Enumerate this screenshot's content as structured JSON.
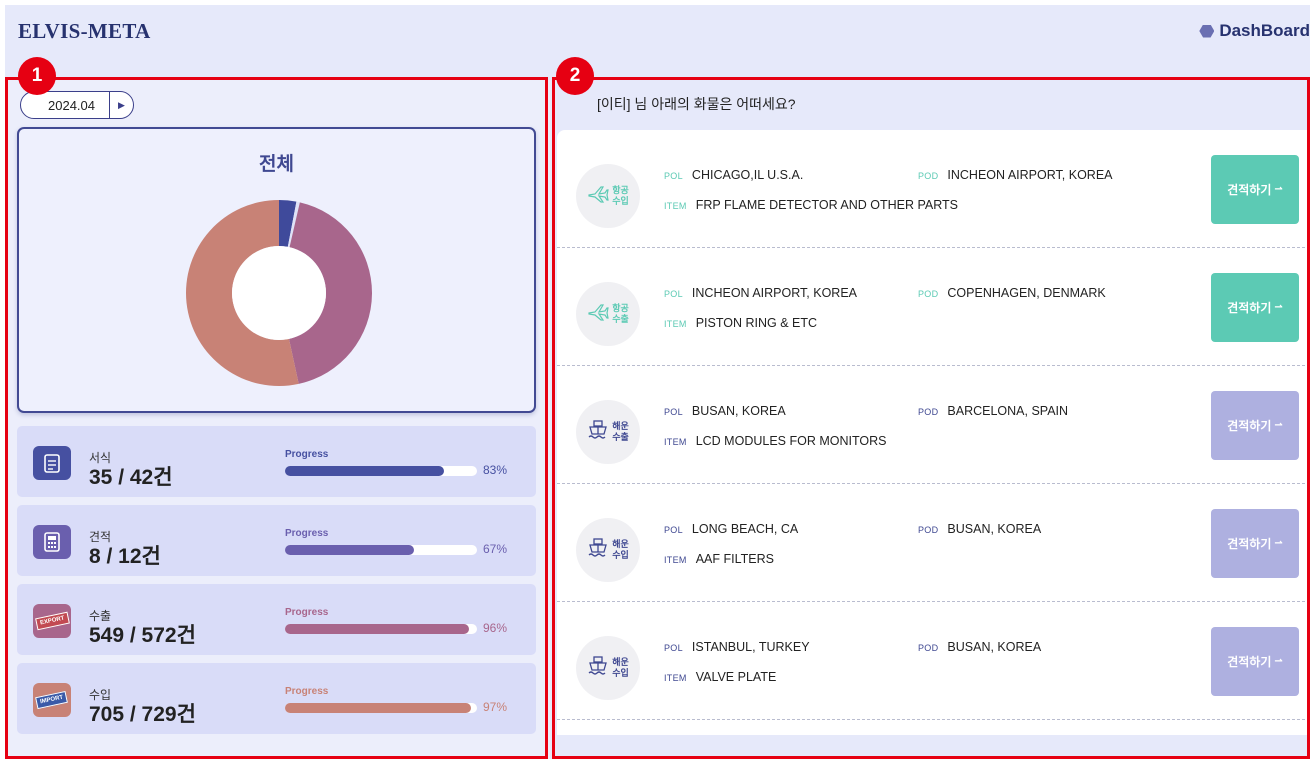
{
  "header": {
    "logo": "ELVIS-META",
    "dashboard_label": "DashBoard"
  },
  "annotations": {
    "box1": "1",
    "box2": "2"
  },
  "left_panel": {
    "month": "2024.04",
    "chart_title": "전체",
    "donut_segments": [
      {
        "value": 3,
        "color": "#3f4a9b"
      },
      {
        "value": 0.6,
        "color": "#dfe2f7"
      },
      {
        "value": 43,
        "color": "#a8668c"
      },
      {
        "value": 53.4,
        "color": "#c88276"
      }
    ],
    "stats": [
      {
        "label": "서식",
        "value": "35 / 42건",
        "progress_label": "Progress",
        "percent": 83,
        "percent_text": "83%",
        "color": "#4650a1",
        "icon": "document-icon"
      },
      {
        "label": "견적",
        "value": "8 / 12건",
        "progress_label": "Progress",
        "percent": 67,
        "percent_text": "67%",
        "color": "#6a5fae",
        "icon": "calculator-icon"
      },
      {
        "label": "수출",
        "value": "549 / 572건",
        "progress_label": "Progress",
        "percent": 96,
        "percent_text": "96%",
        "color": "#a8668c",
        "icon": "export-stamp-icon",
        "stamp": "EXPORT"
      },
      {
        "label": "수입",
        "value": "705 / 729건",
        "progress_label": "Progress",
        "percent": 97,
        "percent_text": "97%",
        "color": "#c88276",
        "icon": "import-stamp-icon",
        "stamp": "IMPORT"
      }
    ]
  },
  "right_panel": {
    "greeting": "[이티] 님 아래의 화물은 어떠세요?",
    "shipments": [
      {
        "mode": "항공\n수입",
        "mode_type": "air",
        "pol": "CHICAGO,IL U.S.A.",
        "pod": "INCHEON AIRPORT, KOREA",
        "item": "FRP FLAME DETECTOR AND OTHER PARTS",
        "button": "견적하기",
        "button_color": "#5ccab4",
        "accent": "#5ccab4"
      },
      {
        "mode": "항공\n수출",
        "mode_type": "air",
        "pol": "INCHEON AIRPORT, KOREA",
        "pod": "COPENHAGEN, DENMARK",
        "item": "PISTON RING & ETC",
        "button": "견적하기",
        "button_color": "#5ccab4",
        "accent": "#5ccab4"
      },
      {
        "mode": "해운\n수출",
        "mode_type": "sea",
        "pol": "BUSAN, KOREA",
        "pod": "BARCELONA, SPAIN",
        "item": "LCD MODULES FOR MONITORS",
        "button": "견적하기",
        "button_color": "#aeb0e0",
        "accent": "#3f4891"
      },
      {
        "mode": "해운\n수입",
        "mode_type": "sea",
        "pol": "LONG BEACH, CA",
        "pod": "BUSAN, KOREA",
        "item": "AAF FILTERS",
        "button": "견적하기",
        "button_color": "#aeb0e0",
        "accent": "#3f4891"
      },
      {
        "mode": "해운\n수입",
        "mode_type": "sea",
        "pol": "ISTANBUL, TURKEY",
        "pod": "BUSAN, KOREA",
        "item": "VALVE PLATE",
        "button": "견적하기",
        "button_color": "#aeb0e0",
        "accent": "#3f4891"
      }
    ],
    "labels": {
      "pol": "POL",
      "pod": "POD",
      "item": "ITEM"
    }
  }
}
